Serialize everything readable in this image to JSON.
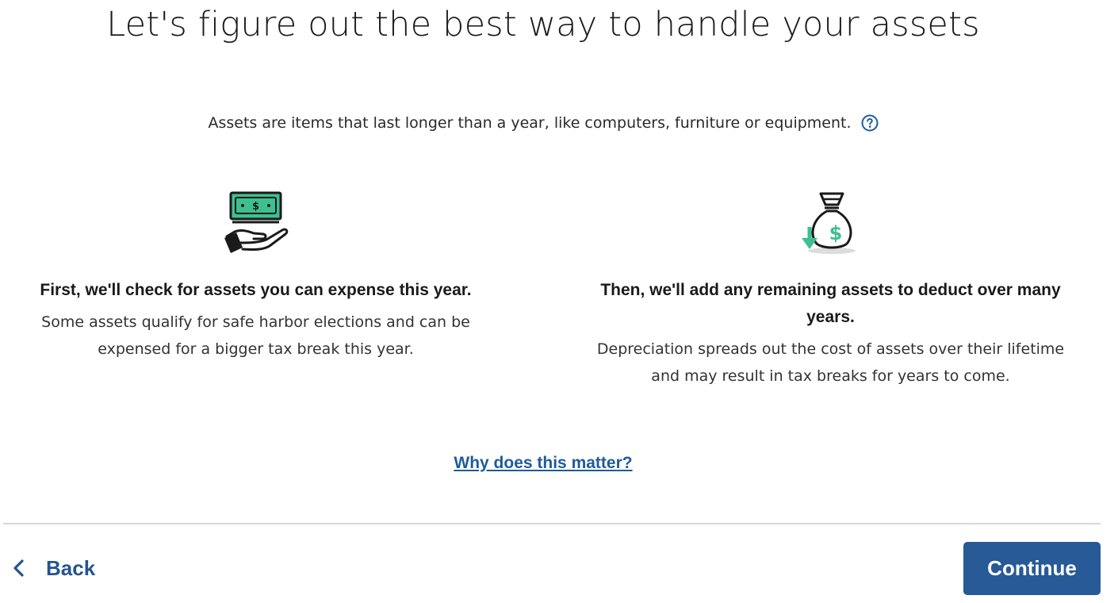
{
  "page": {
    "title": "Let's figure out the best way to handle your assets",
    "intro": "Assets are items that last longer than a year, like computers, furniture or equipment.",
    "help_icon": "question-circle-icon"
  },
  "columns": [
    {
      "icon": "money-in-hand-icon",
      "heading": "First, we'll check for assets you can expense this year.",
      "body": "Some assets qualify for safe harbor elections and can be expensed for a bigger tax break this year."
    },
    {
      "icon": "money-bag-down-arrow-icon",
      "heading": "Then, we'll add any remaining assets to deduct over many years.",
      "body": "Depreciation spreads out the cost of assets over their lifetime and may result in tax breaks for years to come."
    }
  ],
  "links": {
    "why": "Why does this matter?"
  },
  "footer": {
    "back_label": "Back",
    "continue_label": "Continue"
  },
  "colors": {
    "accent": "#275a96",
    "link": "#1f5b9a",
    "illustration_green": "#3fbf8f"
  }
}
